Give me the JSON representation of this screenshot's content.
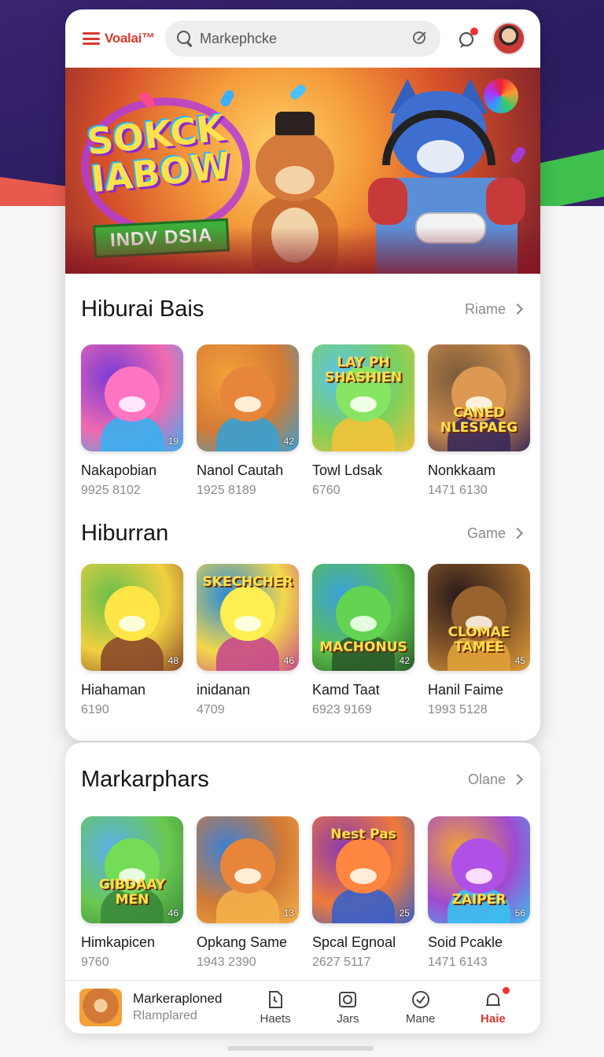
{
  "header": {
    "logo_text": "Voalai™",
    "search_placeholder": "Markephcke"
  },
  "banner": {
    "title": "SOKCK IABOW",
    "ribbon": "INDV DSIA"
  },
  "sections": [
    {
      "title": "Hiburai Bais",
      "more": "Riame",
      "tiles": [
        {
          "name": "Nakapobian",
          "sub": "9925 8102",
          "badge": "19",
          "thumb_label": "",
          "colors": [
            "#7a3ad6",
            "#f06ab0",
            "#3ab0f0"
          ]
        },
        {
          "name": "Nanol Cautah",
          "sub": "1925 8189",
          "badge": "42",
          "thumb_label": "",
          "colors": [
            "#f4a13a",
            "#d27a35",
            "#3aa0d0"
          ]
        },
        {
          "name": "Towl Ldsak",
          "sub": "6760",
          "badge": "",
          "thumb_label": "LAY PH SHASHIEN",
          "colors": [
            "#5ac4f0",
            "#7cd05a",
            "#f3c23a"
          ]
        },
        {
          "name": "Nonkkaam",
          "sub": "1471 6130",
          "badge": "",
          "thumb_label": "CANED NLESPAEG",
          "colors": [
            "#7a5a3a",
            "#c98a4a",
            "#3a2a5a"
          ]
        }
      ]
    },
    {
      "title": "Hiburran",
      "more": "Game",
      "tiles": [
        {
          "name": "Hiahaman",
          "sub": "6190",
          "badge": "48",
          "thumb_label": "",
          "colors": [
            "#6ac04a",
            "#f0d040",
            "#8a4a2a"
          ]
        },
        {
          "name": "inidanan",
          "sub": "4709",
          "badge": "46",
          "thumb_label": "SKECHCHER",
          "colors": [
            "#2a8ad8",
            "#f3d84a",
            "#c84a8a"
          ]
        },
        {
          "name": "Kamd Taat",
          "sub": "6923 9169",
          "badge": "42",
          "thumb_label": "MACHONUS",
          "colors": [
            "#3aa0e0",
            "#5ac04a",
            "#2a5a2a"
          ]
        },
        {
          "name": "Hanil Faime",
          "sub": "1993 5128",
          "badge": "45",
          "thumb_label": "CLOMAE TAMEE",
          "colors": [
            "#2a1a1a",
            "#8a5a2a",
            "#e0a03a"
          ]
        }
      ]
    },
    {
      "title": "Markarphars",
      "more": "Olane",
      "tiles": [
        {
          "name": "Himkapicen",
          "sub": "9760",
          "badge": "46",
          "thumb_label": "GIBDAAY MEN",
          "colors": [
            "#5ab0e8",
            "#6ac850",
            "#3a8a3a"
          ]
        },
        {
          "name": "Opkang Same",
          "sub": "1943 2390",
          "badge": "13",
          "thumb_label": "",
          "colors": [
            "#3a80d8",
            "#d27a35",
            "#f4b04a"
          ]
        },
        {
          "name": "Spcal Egnoal",
          "sub": "2627 5117",
          "badge": "25",
          "thumb_label": "Nest Pas",
          "colors": [
            "#8a3ab0",
            "#f07a3a",
            "#3a60c8"
          ]
        },
        {
          "name": "Soid Pcakle",
          "sub": "1471 6143",
          "badge": "56",
          "thumb_label": "ZAIPER",
          "colors": [
            "#f0a03a",
            "#a04ad0",
            "#3ac0f0"
          ]
        }
      ]
    }
  ],
  "bottom_bar": {
    "mini_title": "Markeraploned",
    "mini_sub": "Rlamplared",
    "nav": [
      {
        "label": "Haets",
        "icon": "document-icon"
      },
      {
        "label": "Jars",
        "icon": "camera-icon"
      },
      {
        "label": "Mane",
        "icon": "check-circle-icon"
      },
      {
        "label": "Haie",
        "icon": "bell-icon"
      }
    ]
  },
  "colors": {
    "brand": "#d63a2f",
    "backdrop": "#2a1c5e"
  }
}
